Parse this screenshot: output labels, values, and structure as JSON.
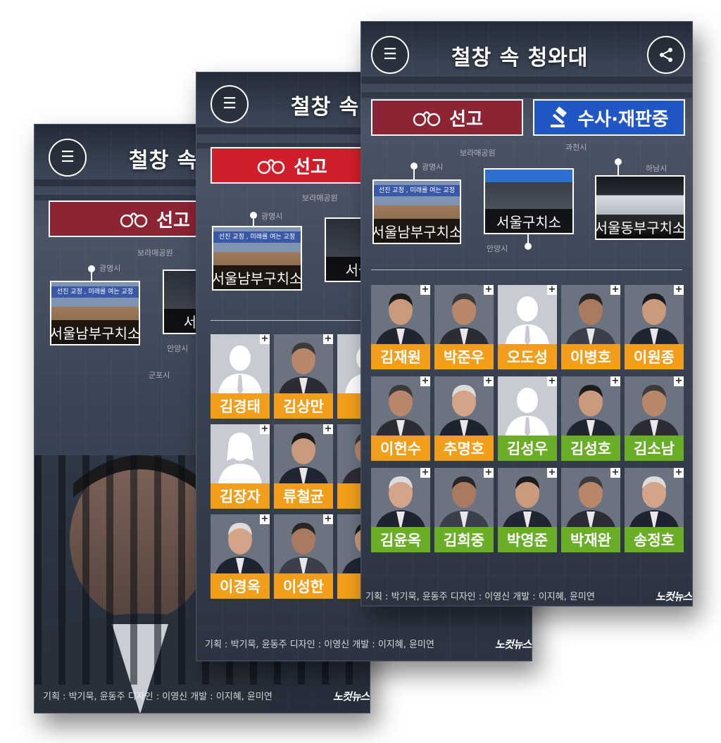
{
  "app": {
    "title": "철창 속 청와대",
    "title_partial_a": "철창 속",
    "title_partial_b": "철창 속"
  },
  "tabs": {
    "sentenced_label": "선고",
    "investigation_label": "수사·재판중"
  },
  "locations": [
    {
      "label": "서울남부구치소",
      "sign": "선진 교정 , 미래를 여는 교정"
    },
    {
      "label": "서울구치소",
      "label_partial": "서울"
    },
    {
      "label": "서울동부구치소"
    }
  ],
  "map_labels": [
    "광명시",
    "안양시",
    "군포시",
    "보라매공원",
    "과천시",
    "하남시"
  ],
  "people_front": [
    {
      "name": "김재원",
      "color": "orange",
      "photo": "portrait"
    },
    {
      "name": "박준우",
      "color": "orange",
      "photo": "portrait"
    },
    {
      "name": "오도성",
      "color": "orange",
      "photo": "silhouette-male"
    },
    {
      "name": "이병호",
      "color": "orange",
      "photo": "portrait"
    },
    {
      "name": "이원종",
      "color": "orange",
      "photo": "portrait"
    },
    {
      "name": "이헌수",
      "color": "orange",
      "photo": "portrait"
    },
    {
      "name": "추명호",
      "color": "orange",
      "photo": "portrait"
    },
    {
      "name": "김성우",
      "color": "green",
      "photo": "silhouette-male"
    },
    {
      "name": "김성호",
      "color": "green",
      "photo": "portrait"
    },
    {
      "name": "김소남",
      "color": "green",
      "photo": "portrait"
    },
    {
      "name": "김윤옥",
      "color": "green",
      "photo": "portrait"
    },
    {
      "name": "김희중",
      "color": "green",
      "photo": "portrait"
    },
    {
      "name": "박영준",
      "color": "green",
      "photo": "portrait"
    },
    {
      "name": "박재완",
      "color": "green",
      "photo": "portrait"
    },
    {
      "name": "송정호",
      "color": "green",
      "photo": "portrait"
    }
  ],
  "people_middle": [
    {
      "name": "김경태",
      "color": "orange",
      "photo": "silhouette-male"
    },
    {
      "name": "김상만",
      "color": "orange",
      "photo": "portrait"
    },
    {
      "name": "김",
      "color": "orange",
      "photo": "silhouette-male"
    },
    {
      "name": "김장자",
      "color": "orange",
      "photo": "silhouette-female"
    },
    {
      "name": "류철균",
      "color": "orange",
      "photo": "portrait"
    },
    {
      "name": "박",
      "color": "orange",
      "photo": "portrait"
    },
    {
      "name": "이경옥",
      "color": "orange",
      "photo": "portrait"
    },
    {
      "name": "이성한",
      "color": "orange",
      "photo": "portrait"
    },
    {
      "name": "이",
      "color": "orange",
      "photo": "portrait"
    }
  ],
  "credits": {
    "text": "기획 : 박기묵, 윤동주   디자인 : 이영신   개발 : 이지혜, 윤미연",
    "logo": "노컷뉴스"
  },
  "colors": {
    "orange": "#f39e1a",
    "green": "#6aad27",
    "tab_red": "#d01f2a",
    "tab_red_dim": "#8c2434",
    "tab_blue": "#2157c4"
  },
  "icons": [
    "menu-icon",
    "share-icon",
    "handcuffs-icon",
    "gavel-icon",
    "plus-icon"
  ]
}
